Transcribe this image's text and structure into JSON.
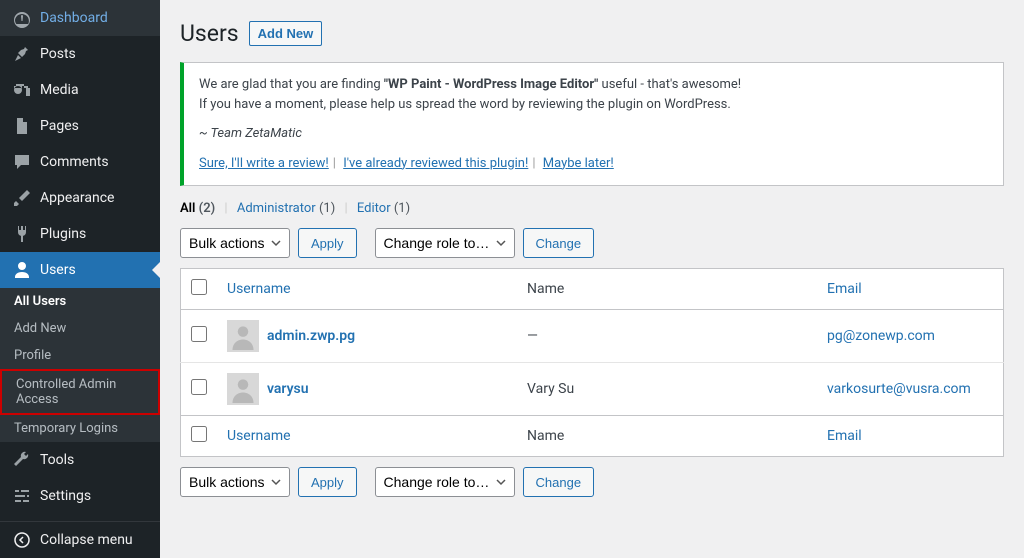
{
  "sidebar": {
    "items": [
      {
        "label": "Dashboard",
        "icon": "dashboard"
      },
      {
        "label": "Posts",
        "icon": "pin"
      },
      {
        "label": "Media",
        "icon": "media"
      },
      {
        "label": "Pages",
        "icon": "page"
      },
      {
        "label": "Comments",
        "icon": "comments"
      },
      {
        "label": "Appearance",
        "icon": "brush"
      },
      {
        "label": "Plugins",
        "icon": "plug"
      },
      {
        "label": "Users",
        "icon": "user",
        "active": true
      },
      {
        "label": "Tools",
        "icon": "wrench"
      },
      {
        "label": "Settings",
        "icon": "sliders"
      }
    ],
    "submenu": [
      {
        "label": "All Users",
        "active": true
      },
      {
        "label": "Add New"
      },
      {
        "label": "Profile"
      },
      {
        "label": "Controlled Admin Access",
        "highlight": true
      },
      {
        "label": "Temporary Logins"
      }
    ],
    "collapse": "Collapse menu"
  },
  "header": {
    "title": "Users",
    "add_new": "Add New"
  },
  "notice": {
    "line1a": "We are glad that you are finding ",
    "bold": "\"WP Paint - WordPress Image Editor\"",
    "line1b": " useful - that's awesome!",
    "line2": "If you have a moment, please help us spread the word by reviewing the plugin on WordPress.",
    "sig": "~ Team ZetaMatic",
    "links": [
      "Sure, I'll write a review!",
      "I've already reviewed this plugin!",
      "Maybe later!"
    ]
  },
  "filters": {
    "all_label": "All",
    "all_count": "(2)",
    "admin_label": "Administrator",
    "admin_count": "(1)",
    "editor_label": "Editor",
    "editor_count": "(1)"
  },
  "actions": {
    "bulk": "Bulk actions",
    "apply": "Apply",
    "role": "Change role to…",
    "change": "Change"
  },
  "table": {
    "cols": {
      "username": "Username",
      "name": "Name",
      "email": "Email"
    },
    "rows": [
      {
        "username": "admin.zwp.pg",
        "name": "—",
        "email": "pg@zonewp.com"
      },
      {
        "username": "varysu",
        "name": "Vary Su",
        "email": "varkosurte@vusra.com"
      }
    ]
  }
}
